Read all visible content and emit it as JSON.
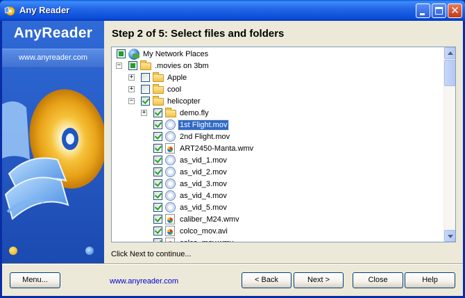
{
  "window": {
    "title": "Any Reader"
  },
  "sidebar": {
    "brand": "AnyReader",
    "url": "www.anyreader.com"
  },
  "wizard": {
    "heading": "Step 2 of 5:  Select files and folders",
    "status": "Click Next to continue..."
  },
  "tree": {
    "rows": [
      {
        "label": "My Network Places",
        "icon": "globe-icon",
        "depth": 0,
        "expander": "none",
        "check": "partial"
      },
      {
        "label": ".movies on 3bm",
        "icon": "folder-icon",
        "depth": 1,
        "expander": "minus",
        "check": "partial"
      },
      {
        "label": "Apple",
        "icon": "folder-icon",
        "depth": 2,
        "expander": "plus",
        "check": "unchecked"
      },
      {
        "label": "cool",
        "icon": "folder-icon",
        "depth": 2,
        "expander": "plus",
        "check": "unchecked"
      },
      {
        "label": "helicopter",
        "icon": "folder-icon",
        "depth": 2,
        "expander": "minus",
        "check": "checked"
      },
      {
        "label": "demo.fly",
        "icon": "folder-icon",
        "depth": 3,
        "expander": "plus",
        "check": "checked"
      },
      {
        "label": "1st Flight.mov",
        "icon": "quicktime-icon",
        "depth": 3,
        "expander": "none",
        "check": "checked",
        "selected": true
      },
      {
        "label": "2nd Flight.mov",
        "icon": "quicktime-icon",
        "depth": 3,
        "expander": "none",
        "check": "checked"
      },
      {
        "label": "ART2450-Manta.wmv",
        "icon": "media-file-icon",
        "depth": 3,
        "expander": "none",
        "check": "checked"
      },
      {
        "label": "as_vid_1.mov",
        "icon": "quicktime-icon",
        "depth": 3,
        "expander": "none",
        "check": "checked"
      },
      {
        "label": "as_vid_2.mov",
        "icon": "quicktime-icon",
        "depth": 3,
        "expander": "none",
        "check": "checked"
      },
      {
        "label": "as_vid_3.mov",
        "icon": "quicktime-icon",
        "depth": 3,
        "expander": "none",
        "check": "checked"
      },
      {
        "label": "as_vid_4.mov",
        "icon": "quicktime-icon",
        "depth": 3,
        "expander": "none",
        "check": "checked"
      },
      {
        "label": "as_vid_5.mov",
        "icon": "quicktime-icon",
        "depth": 3,
        "expander": "none",
        "check": "checked"
      },
      {
        "label": "caliber_M24.wmv",
        "icon": "media-file-icon",
        "depth": 3,
        "expander": "none",
        "check": "checked"
      },
      {
        "label": "colco_mov.avi",
        "icon": "media-file-icon",
        "depth": 3,
        "expander": "none",
        "check": "checked"
      },
      {
        "label": "colco_mov.wmv",
        "icon": "media-file-icon",
        "depth": 3,
        "expander": "none",
        "check": "checked"
      }
    ]
  },
  "footer": {
    "menu_label": "Menu...",
    "link_text": "www.anyreader.com",
    "back_label": "< Back",
    "next_label": "Next >",
    "close_label": "Close",
    "help_label": "Help"
  }
}
